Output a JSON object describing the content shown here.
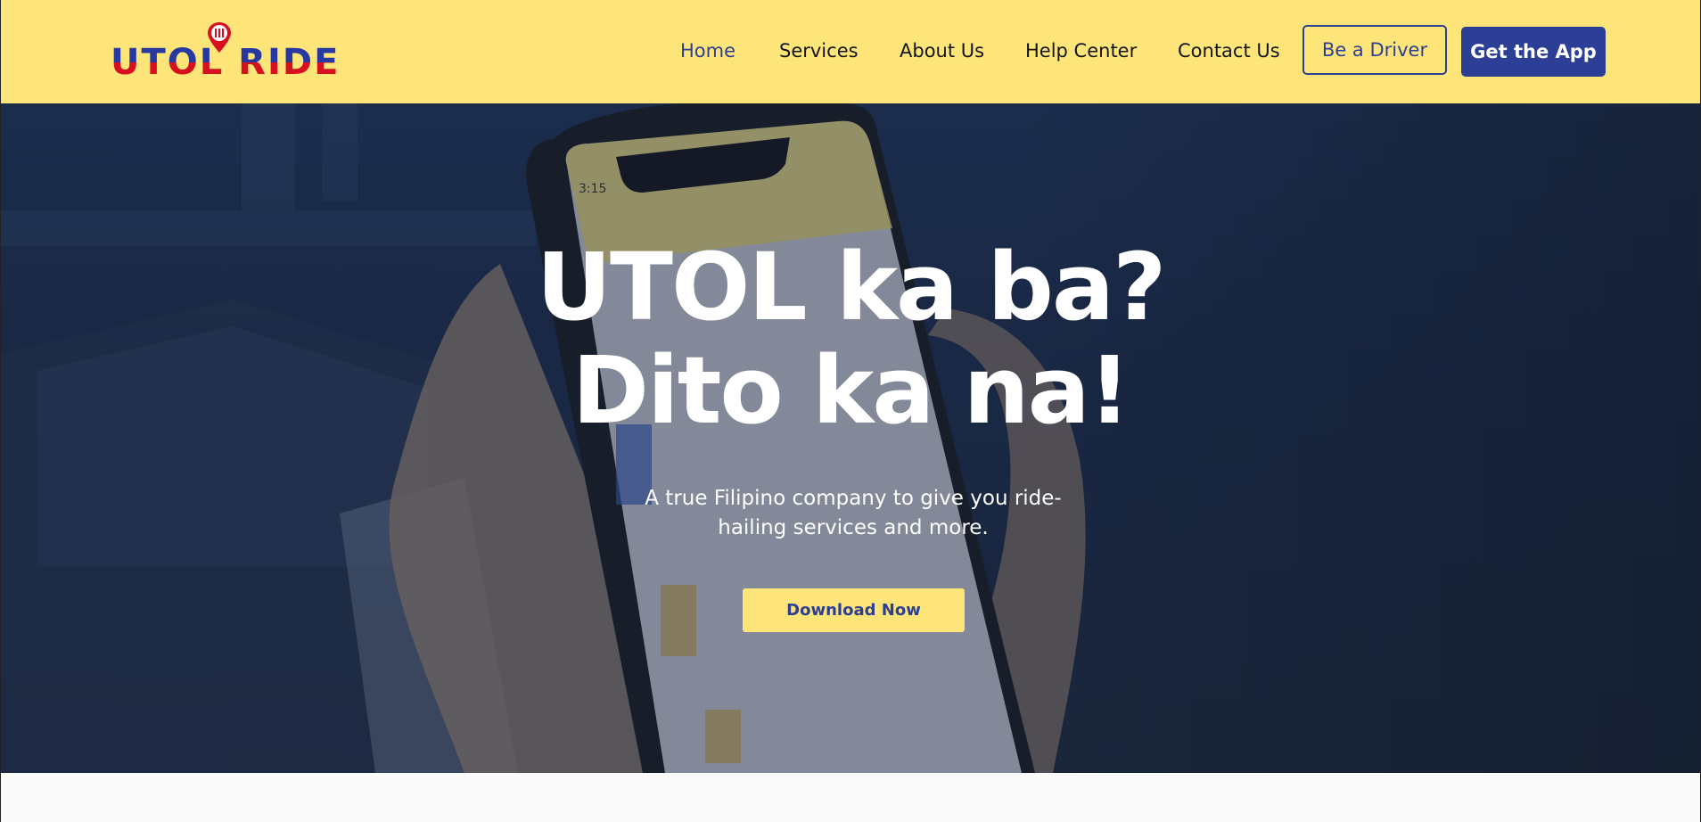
{
  "brand": {
    "logo_text": "UTOL RIDE",
    "colors": {
      "blue": "#2738a0",
      "red": "#d7101f",
      "yellow": "#fde57a"
    }
  },
  "nav": {
    "links": [
      {
        "label": "Home",
        "active": true
      },
      {
        "label": "Services"
      },
      {
        "label": "About Us"
      },
      {
        "label": "Help Center"
      },
      {
        "label": "Contact Us"
      }
    ],
    "driver_button": "Be a Driver",
    "app_button": "Get the App"
  },
  "hero": {
    "title_line1": "UTOL ka ba?",
    "title_line2": "Dito ka na!",
    "subtitle": "A true Filipino company to give you ride-hailing services and more.",
    "cta": "Download Now",
    "phone_time": "3:15",
    "background": "hands holding smartphone with app open"
  }
}
